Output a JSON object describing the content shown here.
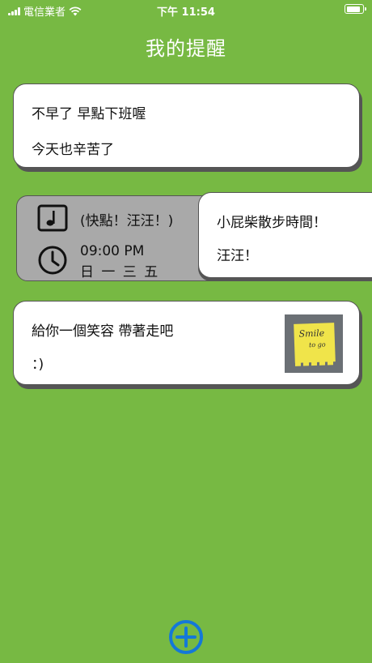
{
  "status_bar": {
    "carrier": "電信業者",
    "time": "下午 11:54"
  },
  "title": "我的提醒",
  "reminders": [
    {
      "line1": "不早了 早點下班喔",
      "line2": "今天也辛苦了"
    },
    {
      "line1": "小屁柴散步時間！",
      "line2": "汪汪！",
      "alarm": {
        "song": "(快點！汪汪！)",
        "time": "09:00 PM",
        "days": "日 一 三 五"
      }
    },
    {
      "line1": "給你一個笑容 帶著走吧",
      "line2": "：)",
      "image_label": "Smile to go"
    }
  ],
  "colors": {
    "background": "#77b943",
    "card": "#ffffff",
    "swipe_background": "#a9a9a9",
    "add_button": "#1478d8"
  },
  "icons": {
    "music": "music-note-icon",
    "clock": "clock-icon",
    "add": "add-circle-icon"
  }
}
